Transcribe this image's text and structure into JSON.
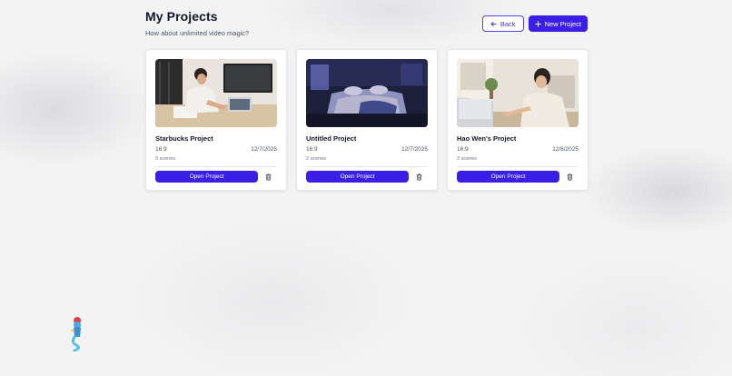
{
  "header": {
    "title": "My Projects",
    "subtitle": "How about unlimited video magic?",
    "back_label": "Back",
    "new_project_label": "New Project"
  },
  "projects": [
    {
      "name": "Starbucks Project",
      "ratio": "16:9",
      "date": "12/7/2025",
      "scenes": "3 scenes",
      "open_label": "Open Project"
    },
    {
      "name": "Untitled Project",
      "ratio": "16:9",
      "date": "12/7/2025",
      "scenes": "2 scenes",
      "open_label": "Open Project"
    },
    {
      "name": "Hao Wen's Project",
      "ratio": "16:9",
      "date": "12/6/2025",
      "scenes": "3 scenes",
      "open_label": "Open Project"
    }
  ],
  "icons": {
    "back": "arrow-left-icon",
    "new": "plus-icon",
    "delete": "trash-icon"
  },
  "colors": {
    "accent": "#3b1fe6",
    "back_border": "#4f46e5"
  }
}
